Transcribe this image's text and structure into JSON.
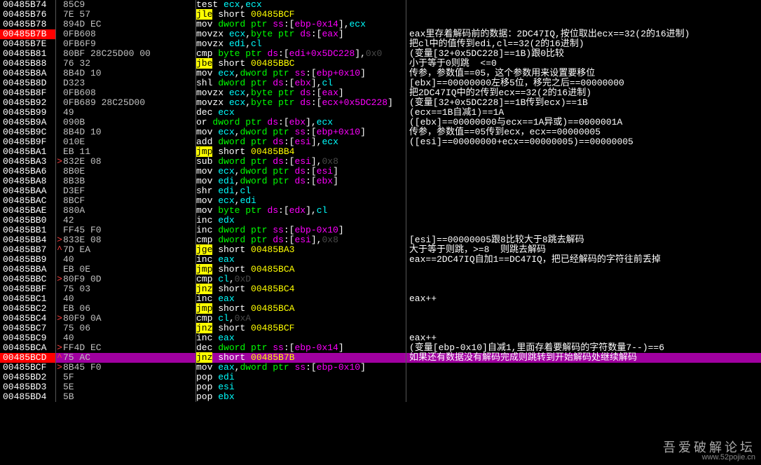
{
  "watermark": {
    "ch": "吾爱破解论坛",
    "url": "www.52pojie.cn"
  },
  "rows": [
    {
      "addr": "00485B74",
      "gut": "",
      "hex": "85C9",
      "dis": [
        {
          "t": "test ",
          "c": "white"
        },
        {
          "t": "ecx",
          "c": "cyan"
        },
        {
          "t": ",",
          "c": "white"
        },
        {
          "t": "ecx",
          "c": "cyan"
        }
      ],
      "cmt": ""
    },
    {
      "addr": "00485B76",
      "gut": "",
      "hex": "7E 57",
      "dis": [
        {
          "t": "jle",
          "c": "yellowbg"
        },
        {
          "t": " short ",
          "c": "white"
        },
        {
          "t": "00485BCF",
          "c": "yellow"
        }
      ],
      "cmt": ""
    },
    {
      "addr": "00485B78",
      "gut": "",
      "hex": "894D EC",
      "dis": [
        {
          "t": "mov ",
          "c": "white"
        },
        {
          "t": "dword ptr ",
          "c": "green"
        },
        {
          "t": "ss",
          "c": "magenta"
        },
        {
          "t": ":[",
          "c": "white"
        },
        {
          "t": "ebp-0x14",
          "c": "magenta"
        },
        {
          "t": "]",
          "c": "white"
        },
        {
          "t": ",",
          "c": "white"
        },
        {
          "t": "ecx",
          "c": "cyan"
        }
      ],
      "cmt": ""
    },
    {
      "addr": "00485B7B",
      "addrClass": "redbg",
      "gut": "",
      "hex": "0FB608",
      "dis": [
        {
          "t": "movzx ",
          "c": "white"
        },
        {
          "t": "ecx",
          "c": "cyan"
        },
        {
          "t": ",",
          "c": "white"
        },
        {
          "t": "byte ptr ",
          "c": "green"
        },
        {
          "t": "ds",
          "c": "magenta"
        },
        {
          "t": ":[",
          "c": "white"
        },
        {
          "t": "eax",
          "c": "magenta"
        },
        {
          "t": "]",
          "c": "white"
        }
      ],
      "cmt": "eax里存着解码前的数据：2DC47IQ,按位取出ecx==32(2的16进制)"
    },
    {
      "addr": "00485B7E",
      "gut": "",
      "hex": "0FB6F9",
      "dis": [
        {
          "t": "movzx ",
          "c": "white"
        },
        {
          "t": "edi",
          "c": "cyan"
        },
        {
          "t": ",",
          "c": "white"
        },
        {
          "t": "cl",
          "c": "cyan"
        }
      ],
      "cmt": "把cl中的值传到edi,cl==32(2的16进制)"
    },
    {
      "addr": "00485B81",
      "gut": "",
      "hex": "80BF 28C25D00 00",
      "dis": [
        {
          "t": "cmp ",
          "c": "white"
        },
        {
          "t": "byte ptr ",
          "c": "green"
        },
        {
          "t": "ds",
          "c": "magenta"
        },
        {
          "t": ":[",
          "c": "white"
        },
        {
          "t": "edi+0x5DC228",
          "c": "magenta"
        },
        {
          "t": "]",
          "c": "white"
        },
        {
          "t": ",",
          "c": "white"
        },
        {
          "t": "0x0",
          "c": "darkgrey"
        }
      ],
      "cmt": "(变量[32+0x5DC228]==1B)跟0比较"
    },
    {
      "addr": "00485B88",
      "gut": "",
      "hex": "76 32",
      "dis": [
        {
          "t": "jbe",
          "c": "yellowbg"
        },
        {
          "t": " short ",
          "c": "white"
        },
        {
          "t": "00485BBC",
          "c": "yellow"
        }
      ],
      "cmt": "小于等于0则跳  <=0"
    },
    {
      "addr": "00485B8A",
      "gut": "",
      "hex": "8B4D 10",
      "dis": [
        {
          "t": "mov ",
          "c": "white"
        },
        {
          "t": "ecx",
          "c": "cyan"
        },
        {
          "t": ",",
          "c": "white"
        },
        {
          "t": "dword ptr ",
          "c": "green"
        },
        {
          "t": "ss",
          "c": "magenta"
        },
        {
          "t": ":[",
          "c": "white"
        },
        {
          "t": "ebp+0x10",
          "c": "magenta"
        },
        {
          "t": "]",
          "c": "white"
        }
      ],
      "cmt": "传参，参数值==05，这个参数用来设置要移位"
    },
    {
      "addr": "00485B8D",
      "gut": "",
      "hex": "D323",
      "dis": [
        {
          "t": "shl ",
          "c": "white"
        },
        {
          "t": "dword ptr ",
          "c": "green"
        },
        {
          "t": "ds",
          "c": "magenta"
        },
        {
          "t": ":[",
          "c": "white"
        },
        {
          "t": "ebx",
          "c": "magenta"
        },
        {
          "t": "]",
          "c": "white"
        },
        {
          "t": ",",
          "c": "white"
        },
        {
          "t": "cl",
          "c": "cyan"
        }
      ],
      "cmt": "[ebx]==00000000左移5位，移完之后==00000000"
    },
    {
      "addr": "00485B8F",
      "gut": "",
      "hex": "0FB608",
      "dis": [
        {
          "t": "movzx ",
          "c": "white"
        },
        {
          "t": "ecx",
          "c": "cyan"
        },
        {
          "t": ",",
          "c": "white"
        },
        {
          "t": "byte ptr ",
          "c": "green"
        },
        {
          "t": "ds",
          "c": "magenta"
        },
        {
          "t": ":[",
          "c": "white"
        },
        {
          "t": "eax",
          "c": "magenta"
        },
        {
          "t": "]",
          "c": "white"
        }
      ],
      "cmt": "把2DC47IQ中的2传到ecx==32(2的16进制)"
    },
    {
      "addr": "00485B92",
      "gut": "",
      "hex": "0FB689 28C25D00",
      "dis": [
        {
          "t": "movzx ",
          "c": "white"
        },
        {
          "t": "ecx",
          "c": "cyan"
        },
        {
          "t": ",",
          "c": "white"
        },
        {
          "t": "byte ptr ",
          "c": "green"
        },
        {
          "t": "ds",
          "c": "magenta"
        },
        {
          "t": ":[",
          "c": "white"
        },
        {
          "t": "ecx+0x5DC228",
          "c": "magenta"
        },
        {
          "t": "]",
          "c": "white"
        }
      ],
      "cmt": "(变量[32+0x5DC228]==1B传到ecx)==1B"
    },
    {
      "addr": "00485B99",
      "gut": "",
      "hex": "49",
      "dis": [
        {
          "t": "dec ",
          "c": "white"
        },
        {
          "t": "ecx",
          "c": "cyan"
        }
      ],
      "cmt": "(ecx==1B自减1)==1A"
    },
    {
      "addr": "00485B9A",
      "gut": "",
      "hex": "090B",
      "dis": [
        {
          "t": "or ",
          "c": "white"
        },
        {
          "t": "dword ptr ",
          "c": "green"
        },
        {
          "t": "ds",
          "c": "magenta"
        },
        {
          "t": ":[",
          "c": "white"
        },
        {
          "t": "ebx",
          "c": "magenta"
        },
        {
          "t": "]",
          "c": "white"
        },
        {
          "t": ",",
          "c": "white"
        },
        {
          "t": "ecx",
          "c": "cyan"
        }
      ],
      "cmt": "([ebx]==00000000与ecx==1A异或)==0000001A"
    },
    {
      "addr": "00485B9C",
      "gut": "",
      "hex": "8B4D 10",
      "dis": [
        {
          "t": "mov ",
          "c": "white"
        },
        {
          "t": "ecx",
          "c": "cyan"
        },
        {
          "t": ",",
          "c": "white"
        },
        {
          "t": "dword ptr ",
          "c": "green"
        },
        {
          "t": "ss",
          "c": "magenta"
        },
        {
          "t": ":[",
          "c": "white"
        },
        {
          "t": "ebp+0x10",
          "c": "magenta"
        },
        {
          "t": "]",
          "c": "white"
        }
      ],
      "cmt": "传参，参数值==05传到ecx，ecx==00000005"
    },
    {
      "addr": "00485B9F",
      "gut": "",
      "hex": "010E",
      "dis": [
        {
          "t": "add ",
          "c": "white"
        },
        {
          "t": "dword ptr ",
          "c": "green"
        },
        {
          "t": "ds",
          "c": "magenta"
        },
        {
          "t": ":[",
          "c": "white"
        },
        {
          "t": "esi",
          "c": "magenta"
        },
        {
          "t": "]",
          "c": "white"
        },
        {
          "t": ",",
          "c": "white"
        },
        {
          "t": "ecx",
          "c": "cyan"
        }
      ],
      "cmt": "([esi]==00000000+ecx==00000005)==00000005"
    },
    {
      "addr": "00485BA1",
      "gut": "",
      "hex": "EB 11",
      "dis": [
        {
          "t": "jmp",
          "c": "yellowbg"
        },
        {
          "t": " short ",
          "c": "white"
        },
        {
          "t": "00485BB4",
          "c": "yellow"
        }
      ],
      "cmt": ""
    },
    {
      "addr": "00485BA3",
      "gut": ">",
      "hex": "832E 08",
      "dis": [
        {
          "t": "sub ",
          "c": "white"
        },
        {
          "t": "dword ptr ",
          "c": "green"
        },
        {
          "t": "ds",
          "c": "magenta"
        },
        {
          "t": ":[",
          "c": "white"
        },
        {
          "t": "esi",
          "c": "magenta"
        },
        {
          "t": "]",
          "c": "white"
        },
        {
          "t": ",",
          "c": "white"
        },
        {
          "t": "0x8",
          "c": "darkgrey"
        }
      ],
      "cmt": ""
    },
    {
      "addr": "00485BA6",
      "gut": "",
      "hex": "8B0E",
      "dis": [
        {
          "t": "mov ",
          "c": "white"
        },
        {
          "t": "ecx",
          "c": "cyan"
        },
        {
          "t": ",",
          "c": "white"
        },
        {
          "t": "dword ptr ",
          "c": "green"
        },
        {
          "t": "ds",
          "c": "magenta"
        },
        {
          "t": ":[",
          "c": "white"
        },
        {
          "t": "esi",
          "c": "magenta"
        },
        {
          "t": "]",
          "c": "white"
        }
      ],
      "cmt": ""
    },
    {
      "addr": "00485BA8",
      "gut": "",
      "hex": "8B3B",
      "dis": [
        {
          "t": "mov ",
          "c": "white"
        },
        {
          "t": "edi",
          "c": "cyan"
        },
        {
          "t": ",",
          "c": "white"
        },
        {
          "t": "dword ptr ",
          "c": "green"
        },
        {
          "t": "ds",
          "c": "magenta"
        },
        {
          "t": ":[",
          "c": "white"
        },
        {
          "t": "ebx",
          "c": "magenta"
        },
        {
          "t": "]",
          "c": "white"
        }
      ],
      "cmt": ""
    },
    {
      "addr": "00485BAA",
      "gut": "",
      "hex": "D3EF",
      "dis": [
        {
          "t": "shr ",
          "c": "white"
        },
        {
          "t": "edi",
          "c": "cyan"
        },
        {
          "t": ",",
          "c": "white"
        },
        {
          "t": "cl",
          "c": "cyan"
        }
      ],
      "cmt": ""
    },
    {
      "addr": "00485BAC",
      "gut": "",
      "hex": "8BCF",
      "dis": [
        {
          "t": "mov ",
          "c": "white"
        },
        {
          "t": "ecx",
          "c": "cyan"
        },
        {
          "t": ",",
          "c": "white"
        },
        {
          "t": "edi",
          "c": "cyan"
        }
      ],
      "cmt": ""
    },
    {
      "addr": "00485BAE",
      "gut": "",
      "hex": "880A",
      "dis": [
        {
          "t": "mov ",
          "c": "white"
        },
        {
          "t": "byte ptr ",
          "c": "green"
        },
        {
          "t": "ds",
          "c": "magenta"
        },
        {
          "t": ":[",
          "c": "white"
        },
        {
          "t": "edx",
          "c": "magenta"
        },
        {
          "t": "]",
          "c": "white"
        },
        {
          "t": ",",
          "c": "white"
        },
        {
          "t": "cl",
          "c": "cyan"
        }
      ],
      "cmt": ""
    },
    {
      "addr": "00485BB0",
      "gut": "",
      "hex": "42",
      "dis": [
        {
          "t": "inc ",
          "c": "white"
        },
        {
          "t": "edx",
          "c": "cyan"
        }
      ],
      "cmt": ""
    },
    {
      "addr": "00485BB1",
      "gut": "",
      "hex": "FF45 F0",
      "dis": [
        {
          "t": "inc ",
          "c": "white"
        },
        {
          "t": "dword ptr ",
          "c": "green"
        },
        {
          "t": "ss",
          "c": "magenta"
        },
        {
          "t": ":[",
          "c": "white"
        },
        {
          "t": "ebp-0x10",
          "c": "magenta"
        },
        {
          "t": "]",
          "c": "white"
        }
      ],
      "cmt": ""
    },
    {
      "addr": "00485BB4",
      "gut": ">",
      "hex": "833E 08",
      "dis": [
        {
          "t": "cmp ",
          "c": "white"
        },
        {
          "t": "dword ptr ",
          "c": "green"
        },
        {
          "t": "ds",
          "c": "magenta"
        },
        {
          "t": ":[",
          "c": "white"
        },
        {
          "t": "esi",
          "c": "magenta"
        },
        {
          "t": "]",
          "c": "white"
        },
        {
          "t": ",",
          "c": "white"
        },
        {
          "t": "0x8",
          "c": "darkgrey"
        }
      ],
      "cmt": "[esi]==00000005跟8比较大于8跳去解码"
    },
    {
      "addr": "00485BB7",
      "gut": "^",
      "hex": "7D EA",
      "dis": [
        {
          "t": "jge",
          "c": "yellowbg"
        },
        {
          "t": " short ",
          "c": "white"
        },
        {
          "t": "00485BA3",
          "c": "yellow"
        }
      ],
      "cmt": "大于等于则跳，>=8  则跳去解码"
    },
    {
      "addr": "00485BB9",
      "gut": "",
      "hex": "40",
      "dis": [
        {
          "t": "inc ",
          "c": "white"
        },
        {
          "t": "eax",
          "c": "cyan"
        }
      ],
      "cmt": "eax==2DC47IQ自加1==DC47IQ，把已经解码的字符往前丢掉"
    },
    {
      "addr": "00485BBA",
      "gut": "",
      "hex": "EB 0E",
      "dis": [
        {
          "t": "jmp",
          "c": "yellowbg"
        },
        {
          "t": " short ",
          "c": "white"
        },
        {
          "t": "00485BCA",
          "c": "yellow"
        }
      ],
      "cmt": ""
    },
    {
      "addr": "00485BBC",
      "gut": ">",
      "hex": "80F9 0D",
      "dis": [
        {
          "t": "cmp ",
          "c": "white"
        },
        {
          "t": "cl",
          "c": "cyan"
        },
        {
          "t": ",",
          "c": "white"
        },
        {
          "t": "0xD",
          "c": "darkgrey"
        }
      ],
      "cmt": ""
    },
    {
      "addr": "00485BBF",
      "gut": "",
      "hex": "75 03",
      "dis": [
        {
          "t": "jnz",
          "c": "yellowbg"
        },
        {
          "t": " short ",
          "c": "white"
        },
        {
          "t": "00485BC4",
          "c": "yellow"
        }
      ],
      "cmt": ""
    },
    {
      "addr": "00485BC1",
      "gut": "",
      "hex": "40",
      "dis": [
        {
          "t": "inc ",
          "c": "white"
        },
        {
          "t": "eax",
          "c": "cyan"
        }
      ],
      "cmt": "eax++"
    },
    {
      "addr": "00485BC2",
      "gut": "",
      "hex": "EB 06",
      "dis": [
        {
          "t": "jmp",
          "c": "yellowbg"
        },
        {
          "t": " short ",
          "c": "white"
        },
        {
          "t": "00485BCA",
          "c": "yellow"
        }
      ],
      "cmt": ""
    },
    {
      "addr": "00485BC4",
      "gut": ">",
      "hex": "80F9 0A",
      "dis": [
        {
          "t": "cmp ",
          "c": "white"
        },
        {
          "t": "cl",
          "c": "cyan"
        },
        {
          "t": ",",
          "c": "white"
        },
        {
          "t": "0xA",
          "c": "darkgrey"
        }
      ],
      "cmt": ""
    },
    {
      "addr": "00485BC7",
      "gut": "",
      "hex": "75 06",
      "dis": [
        {
          "t": "jnz",
          "c": "yellowbg"
        },
        {
          "t": " short ",
          "c": "white"
        },
        {
          "t": "00485BCF",
          "c": "yellow"
        }
      ],
      "cmt": ""
    },
    {
      "addr": "00485BC9",
      "gut": "",
      "hex": "40",
      "dis": [
        {
          "t": "inc ",
          "c": "white"
        },
        {
          "t": "eax",
          "c": "cyan"
        }
      ],
      "cmt": "eax++"
    },
    {
      "addr": "00485BCA",
      "gut": ">",
      "hex": "FF4D EC",
      "dis": [
        {
          "t": "dec ",
          "c": "white"
        },
        {
          "t": "dword ptr ",
          "c": "green"
        },
        {
          "t": "ss",
          "c": "magenta"
        },
        {
          "t": ":[",
          "c": "white"
        },
        {
          "t": "ebp-0x14",
          "c": "magenta"
        },
        {
          "t": "]",
          "c": "white"
        }
      ],
      "cmt": "(变量[ebp-0x10]自减1,里面存着要解码的字符数量7--)==6"
    },
    {
      "addr": "00485BCD",
      "addrClass": "redbg",
      "rowClass": "purplebg",
      "gut": "^",
      "hex": "75 AC",
      "dis": [
        {
          "t": "jnz",
          "c": "yellowbg"
        },
        {
          "t": " short ",
          "c": "white"
        },
        {
          "t": "00485B7B",
          "c": "yellow"
        }
      ],
      "cmt": "如果还有数据没有解码完成则跳转到开始解码处继续解码"
    },
    {
      "addr": "00485BCF",
      "gut": ">",
      "hex": "8B45 F0",
      "dis": [
        {
          "t": "mov ",
          "c": "white"
        },
        {
          "t": "eax",
          "c": "cyan"
        },
        {
          "t": ",",
          "c": "white"
        },
        {
          "t": "dword ptr ",
          "c": "green"
        },
        {
          "t": "ss",
          "c": "magenta"
        },
        {
          "t": ":[",
          "c": "white"
        },
        {
          "t": "ebp-0x10",
          "c": "magenta"
        },
        {
          "t": "]",
          "c": "white"
        }
      ],
      "cmt": ""
    },
    {
      "addr": "00485BD2",
      "gut": "",
      "hex": "5F",
      "dis": [
        {
          "t": "pop ",
          "c": "white"
        },
        {
          "t": "edi",
          "c": "cyan"
        }
      ],
      "cmt": ""
    },
    {
      "addr": "00485BD3",
      "gut": "",
      "hex": "5E",
      "dis": [
        {
          "t": "pop ",
          "c": "white"
        },
        {
          "t": "esi",
          "c": "cyan"
        }
      ],
      "cmt": ""
    },
    {
      "addr": "00485BD4",
      "gut": "",
      "hex": "5B",
      "dis": [
        {
          "t": "pop ",
          "c": "white"
        },
        {
          "t": "ebx",
          "c": "cyan"
        }
      ],
      "cmt": ""
    }
  ]
}
